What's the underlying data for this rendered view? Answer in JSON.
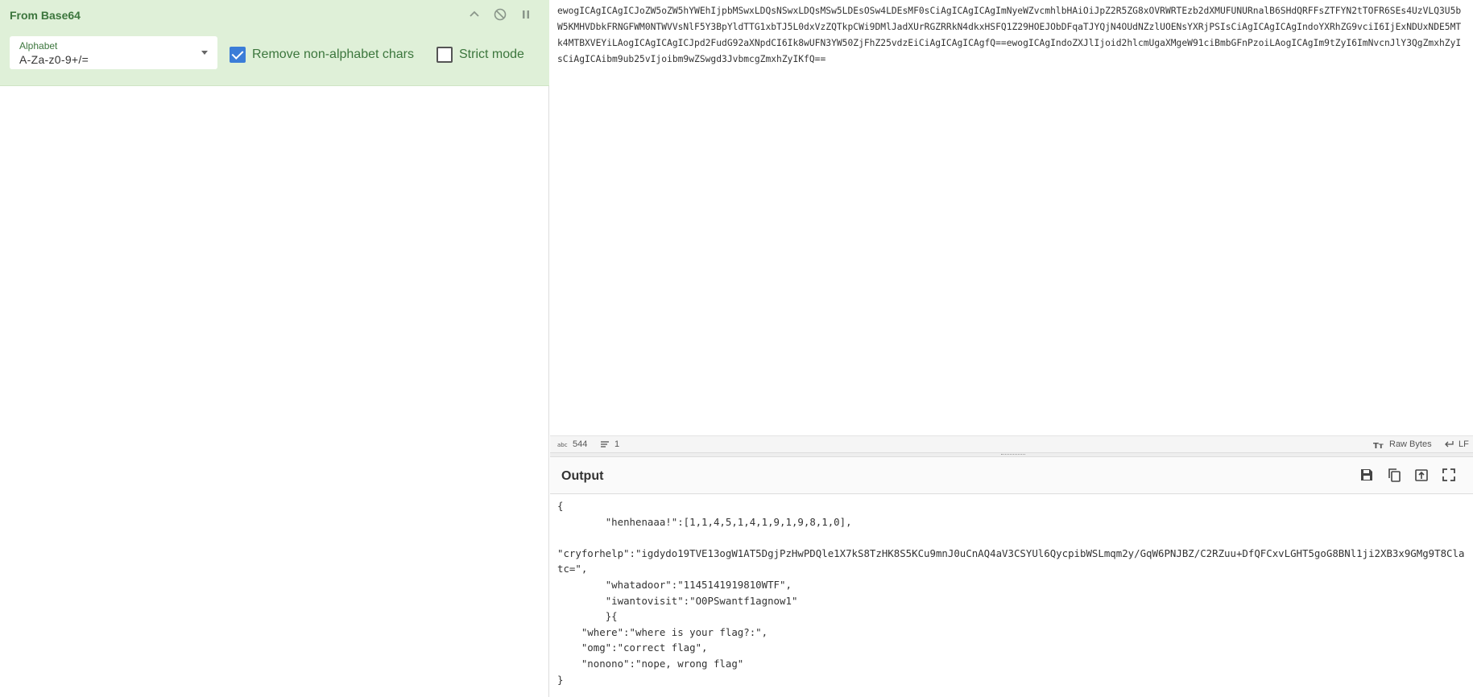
{
  "recipe": {
    "op_title": "From Base64",
    "alphabet_label": "Alphabet",
    "alphabet_value": "A-Za-z0-9+/=",
    "remove_non_alpha_label": "Remove non-alphabet chars",
    "remove_non_alpha_checked": true,
    "strict_mode_label": "Strict mode",
    "strict_mode_checked": false,
    "accent_color": "#3c763d",
    "card_bg": "#dff0d8"
  },
  "input": {
    "text": "ewogICAgICAgICJoZW5oZW5hYWEhIjpbMSwxLDQsNSwxLDQsMSw5LDEsOSw4LDEsMF0sCiAgICAgICAgImNyeWZvcmhlbHAiOiJpZ2R5ZG8xOVRWRTEzb2dXMUFUNURnalB6SHdQRFFsZTFYN2tTOFR6SEs4UzVLQ3U5bW5KMHVDbkFRNGFWM0NTWVVsNlF5Y3BpYldTTG1xbTJ5L0dxVzZQTkpCWi9DMlJadXUrRGZRRkN4dkxHSFQ1Z29HOEJObDFqaTJYQjN4OUdNZzlUOENsYXRjPSIsCiAgICAgICAgIndoYXRhZG9vciI6IjExNDUxNDE5MTk4MTBXVEYiLAogICAgICAgICJpd2FudG92aXNpdCI6Ik8wUFN3YW50ZjFhZ25vdzEiCiAgICAgICAgfQ==ewogICAgIndoZXJlIjoid2hlcmUgaXMgeW91ciBmbGFnPzoiLAogICAgIm9tZyI6ImNvcnJlY3QgZmxhZyIsCiAgICAibm9ub25vIjoibm9wZSwgd3JvbmcgZmxhZyIKfQ==",
    "char_count": "544",
    "line_count": "1",
    "encoding": "Raw Bytes",
    "eol": "LF"
  },
  "output": {
    "title": "Output",
    "text": "{\n        \"henhenaaa!\":[1,1,4,5,1,4,1,9,1,9,8,1,0],\n\n\"cryforhelp\":\"igdydo19TVE13ogW1AT5DgjPzHwPDQle1X7kS8TzHK8S5KCu9mnJ0uCnAQ4aV3CSYUl6QycpibWSLmqm2y/GqW6PNJBZ/C2RZuu+DfQFCxvLGHT5goG8BNl1ji2XB3x9GMg9T8Clatc=\",\n        \"whatadoor\":\"1145141919810WTF\",\n        \"iwantovisit\":\"O0PSwantf1agnow1\"\n        }{\n    \"where\":\"where is your flag?:\",\n    \"omg\":\"correct flag\",\n    \"nonono\":\"nope, wrong flag\"\n}"
  }
}
